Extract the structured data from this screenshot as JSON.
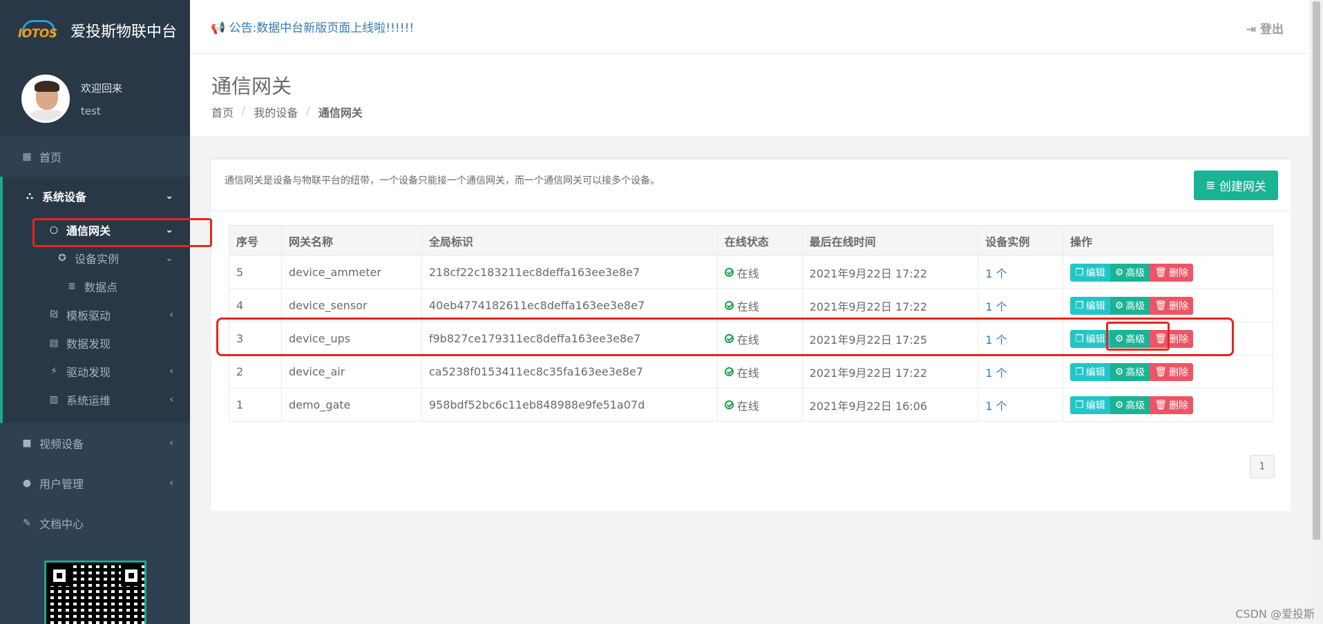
{
  "brand": {
    "logo_text": "IOTOS",
    "title": "爱投斯物联中台"
  },
  "profile": {
    "welcome": "欢迎回来",
    "username": "test"
  },
  "sidebar": {
    "home": "首页",
    "system_devices": "系统设备",
    "gateway": "通信网关",
    "device_instance": "设备实例",
    "data_point": "数据点",
    "template_driver": "模板驱动",
    "data_discovery": "数据发现",
    "driver_discovery": "驱动发现",
    "system_ops": "系统运维",
    "video_devices": "视频设备",
    "user_management": "用户管理",
    "docs_center": "文档中心"
  },
  "topbar": {
    "notice": "公告:数据中台新版页面上线啦!!!!!!",
    "logout": "登出"
  },
  "page": {
    "title": "通信网关",
    "breadcrumb": [
      "首页",
      "我的设备",
      "通信网关"
    ],
    "description": "通信网关是设备与物联平台的纽带，一个设备只能接一个通信网关，而一个通信网关可以接多个设备。",
    "create_button": "创建网关"
  },
  "table": {
    "headers": [
      "序号",
      "网关名称",
      "全局标识",
      "在线状态",
      "最后在线时间",
      "设备实例",
      "操作"
    ],
    "rows": [
      {
        "id": "5",
        "name": "device_ammeter",
        "uid": "218cf22c183211ec8deffa163ee3e8e7",
        "status": "在线",
        "last_online": "2021年9月22日 17:22",
        "instances": "1 个"
      },
      {
        "id": "4",
        "name": "device_sensor",
        "uid": "40eb4774182611ec8deffa163ee3e8e7",
        "status": "在线",
        "last_online": "2021年9月22日 17:22",
        "instances": "1 个"
      },
      {
        "id": "3",
        "name": "device_ups",
        "uid": "f9b827ce179311ec8deffa163ee3e8e7",
        "status": "在线",
        "last_online": "2021年9月22日 17:25",
        "instances": "1 个"
      },
      {
        "id": "2",
        "name": "device_air",
        "uid": "ca5238f0153411ec8c35fa163ee3e8e7",
        "status": "在线",
        "last_online": "2021年9月22日 17:22",
        "instances": "1 个"
      },
      {
        "id": "1",
        "name": "demo_gate",
        "uid": "958bdf52bc6c11eb848988e9fe51a07d",
        "status": "在线",
        "last_online": "2021年9月22日 16:06",
        "instances": "1 个"
      }
    ],
    "actions": {
      "edit": "编辑",
      "advanced": "高级",
      "delete": "删除"
    }
  },
  "pagination": {
    "current_page": "1"
  },
  "watermark": "CSDN @爱投斯",
  "colors": {
    "sidebar": "#2f4050",
    "accent": "#1ab394",
    "info": "#23c6c8",
    "danger": "#ed5565",
    "annotation": "#e8231e"
  }
}
